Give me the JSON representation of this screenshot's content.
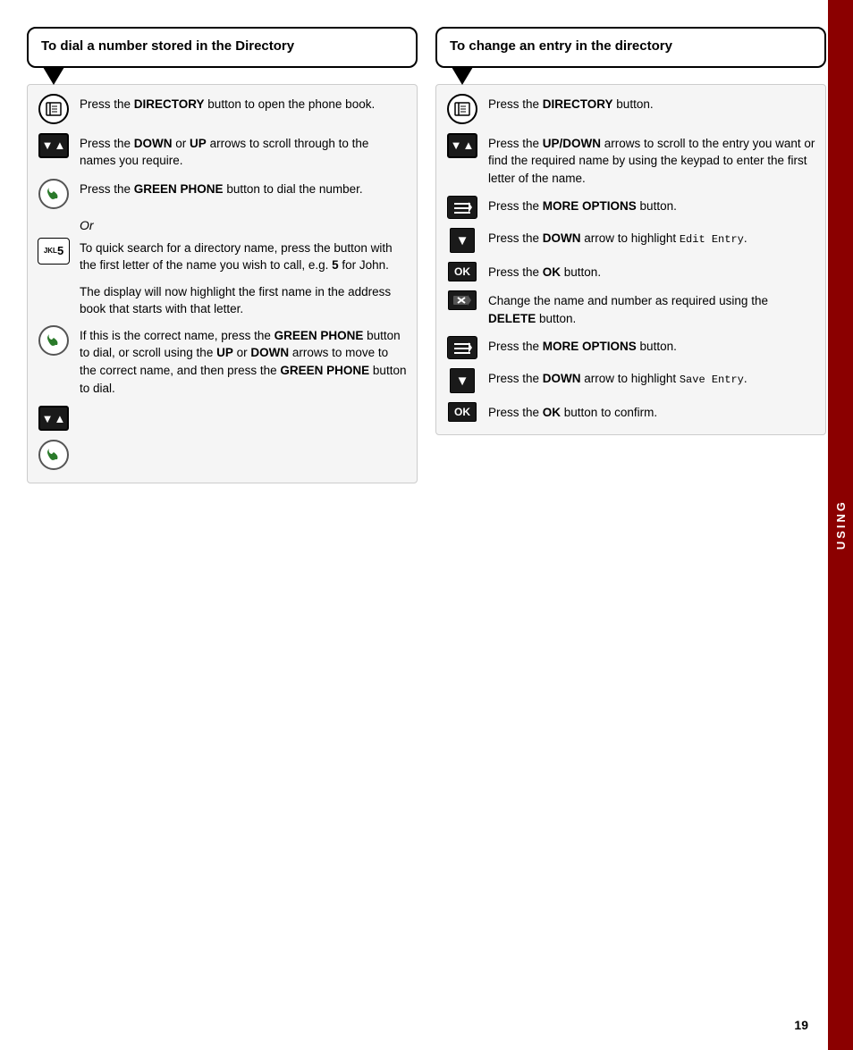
{
  "left_section": {
    "title": "To dial a number stored in the Directory",
    "steps": [
      {
        "icon": "directory",
        "text_html": "Press the <b>DIRECTORY</b> button to open the phone book."
      },
      {
        "icon": "updown",
        "text_html": "Press the <b>DOWN</b> or <b>UP</b> arrows to scroll through to the names you require."
      },
      {
        "icon": "green-phone",
        "text_html": "Press the <b>GREEN PHONE</b> button to dial the number."
      },
      {
        "icon": "none",
        "italic": "Or",
        "text_html": ""
      },
      {
        "icon": "none",
        "text_html": "To quick search for a directory name, press the button with the first letter of the name you wish to call, e.g. <b>5</b> for John."
      },
      {
        "icon": "keypad",
        "keypad_top": "JKL",
        "keypad_num": "5",
        "text_html": ""
      },
      {
        "icon": "none",
        "text_html": "The display will now highlight the first name in the address book that starts with that letter."
      },
      {
        "icon": "green-phone",
        "text_html": "If this is the correct name, press the <b>GREEN PHONE</b> button to dial, or scroll using the <b>UP</b> or <b>DOWN</b> arrows to move to the correct name, and then press the <b>GREEN PHONE</b> button to dial."
      },
      {
        "icon": "updown",
        "text_html": ""
      },
      {
        "icon": "green-phone",
        "text_html": ""
      }
    ]
  },
  "right_section": {
    "title": "To change an entry in the directory",
    "steps": [
      {
        "icon": "directory",
        "text_html": "Press the <b>DIRECTORY</b> button."
      },
      {
        "icon": "updown",
        "text_html": "Press the <b>UP/DOWN</b> arrows to scroll to the entry you want or find the required name by using the keypad to enter the first letter of the name."
      },
      {
        "icon": "more-options",
        "text_html": "Press the <b>MORE OPTIONS</b> button."
      },
      {
        "icon": "down-arrow",
        "text_html": "Press the <b>DOWN</b> arrow to highlight <span class=\"monospace\">Edit Entry</span>."
      },
      {
        "icon": "ok",
        "text_html": "Press the <b>OK</b> button."
      },
      {
        "icon": "delete",
        "text_html": "Change the name and number as required using the <b>DELETE</b> button."
      },
      {
        "icon": "more-options",
        "text_html": "Press the <b>MORE OPTIONS</b> button."
      },
      {
        "icon": "down-arrow",
        "text_html": "Press the <b>DOWN</b> arrow to highlight <span class=\"monospace\">Save Entry</span>."
      },
      {
        "icon": "ok",
        "text_html": "Press the <b>OK</b> button to confirm."
      }
    ]
  },
  "sidebar": {
    "label": "USING"
  },
  "page_number": "19"
}
